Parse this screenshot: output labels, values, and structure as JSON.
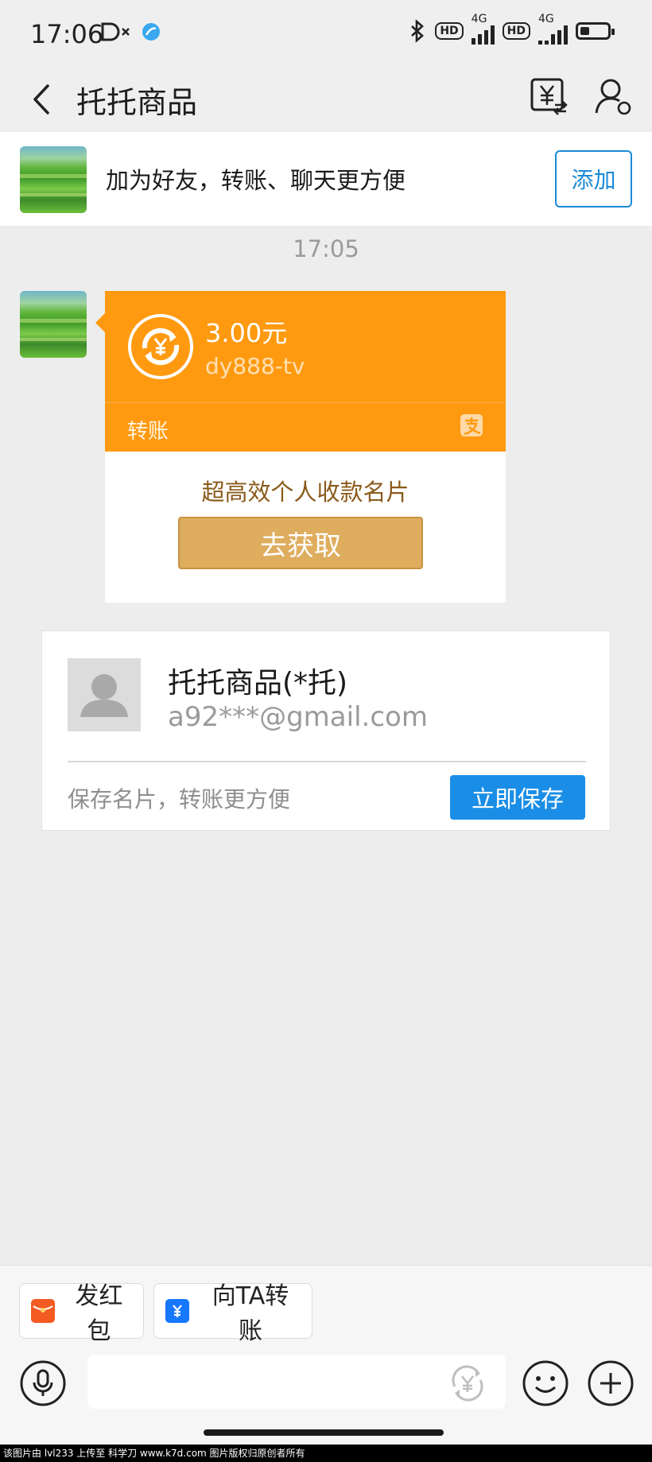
{
  "status_bar": {
    "time": "17:06",
    "network_label_1": "4G",
    "network_label_2": "4G",
    "hd_label_1": "HD",
    "hd_label_2": "HD",
    "battery_level": 0.35
  },
  "header": {
    "title": "托托商品"
  },
  "banner": {
    "text": "加为好友，转账、聊天更方便",
    "add_label": "添加"
  },
  "chat": {
    "timestamp": "17:05",
    "transfer_card": {
      "amount": "3.00元",
      "payee": "dy888-tv",
      "kind": "转账",
      "headline": "超高效个人收款名片",
      "action_label": "去获取"
    },
    "contact_card": {
      "name": "托托商品(*托)",
      "email": "a92***@gmail.com",
      "tip": "保存名片，转账更方便",
      "save_label": "立即保存"
    }
  },
  "quick_actions": [
    {
      "label": "发红包",
      "icon": "red-packet-icon",
      "color": "#f35b22"
    },
    {
      "label": "向TA转账",
      "icon": "transfer-icon",
      "color": "#1677ff"
    }
  ],
  "input": {
    "placeholder": ""
  },
  "colors": {
    "accent_blue": "#1a8ee6",
    "transfer_orange": "#ff9a10",
    "get_button": "#dfad5e"
  },
  "watermark": "该图片由 lvl233 上传至 科学刀 www.k7d.com 图片版权归原创者所有"
}
